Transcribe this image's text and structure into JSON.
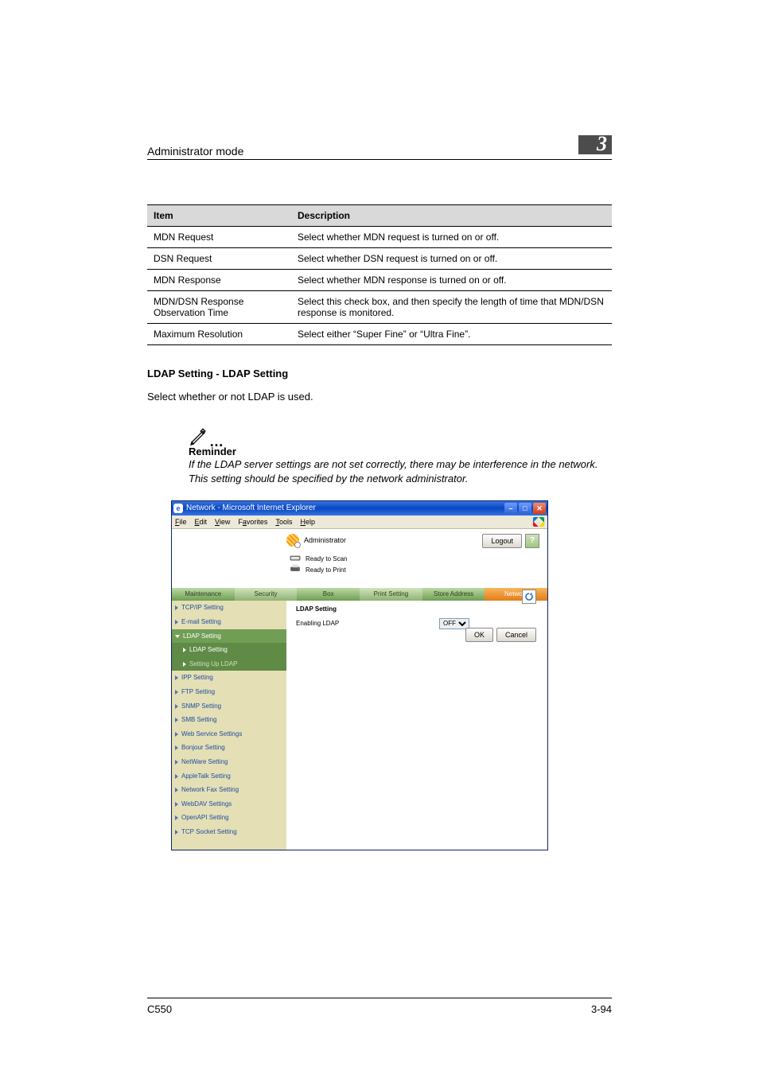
{
  "header": {
    "title": "Administrator mode",
    "chapter": "3"
  },
  "table": {
    "headers": {
      "item": "Item",
      "desc": "Description"
    },
    "rows": [
      {
        "item": "MDN Request",
        "desc": "Select whether MDN request is turned on or off."
      },
      {
        "item": "DSN Request",
        "desc": "Select whether DSN request is turned on or off."
      },
      {
        "item": "MDN Response",
        "desc": "Select whether MDN response is turned on or off."
      },
      {
        "item": "MDN/DSN Response Observation Time",
        "desc": "Select this check box, and then specify the length of time that MDN/DSN response is monitored."
      },
      {
        "item": "Maximum Resolution",
        "desc": "Select either “Super Fine” or “Ultra Fine”."
      }
    ]
  },
  "section": {
    "title": "LDAP Setting - LDAP Setting",
    "body": "Select whether or not LDAP is used."
  },
  "note": {
    "title": "Reminder",
    "body": "If the LDAP server settings are not set correctly, there may be interference in the network. This setting should be specified by the network administrator."
  },
  "browser": {
    "title": "Network - Microsoft Internet Explorer",
    "menus": [
      "File",
      "Edit",
      "View",
      "Favorites",
      "Tools",
      "Help"
    ],
    "admin_label": "Administrator",
    "logout": "Logout",
    "status": {
      "scan": "Ready to Scan",
      "print": "Ready to Print"
    },
    "tabs": [
      "Maintenance",
      "Security",
      "Box",
      "Print Setting",
      "Store Address",
      "Network"
    ],
    "nav": [
      "TCP/IP Setting",
      "E-mail Setting",
      "LDAP Setting",
      "LDAP Setting",
      "Setting Up LDAP",
      "IPP Setting",
      "FTP Setting",
      "SNMP Setting",
      "SMB Setting",
      "Web Service Settings",
      "Bonjour Setting",
      "NetWare Setting",
      "AppleTalk Setting",
      "Network Fax Setting",
      "WebDAV Settings",
      "OpenAPI Setting",
      "TCP Socket Setting"
    ],
    "main": {
      "heading": "LDAP Setting",
      "row_label": "Enabling LDAP",
      "select_value": "OFF",
      "ok": "OK",
      "cancel": "Cancel"
    }
  },
  "footer": {
    "left": "C550",
    "right": "3-94"
  }
}
